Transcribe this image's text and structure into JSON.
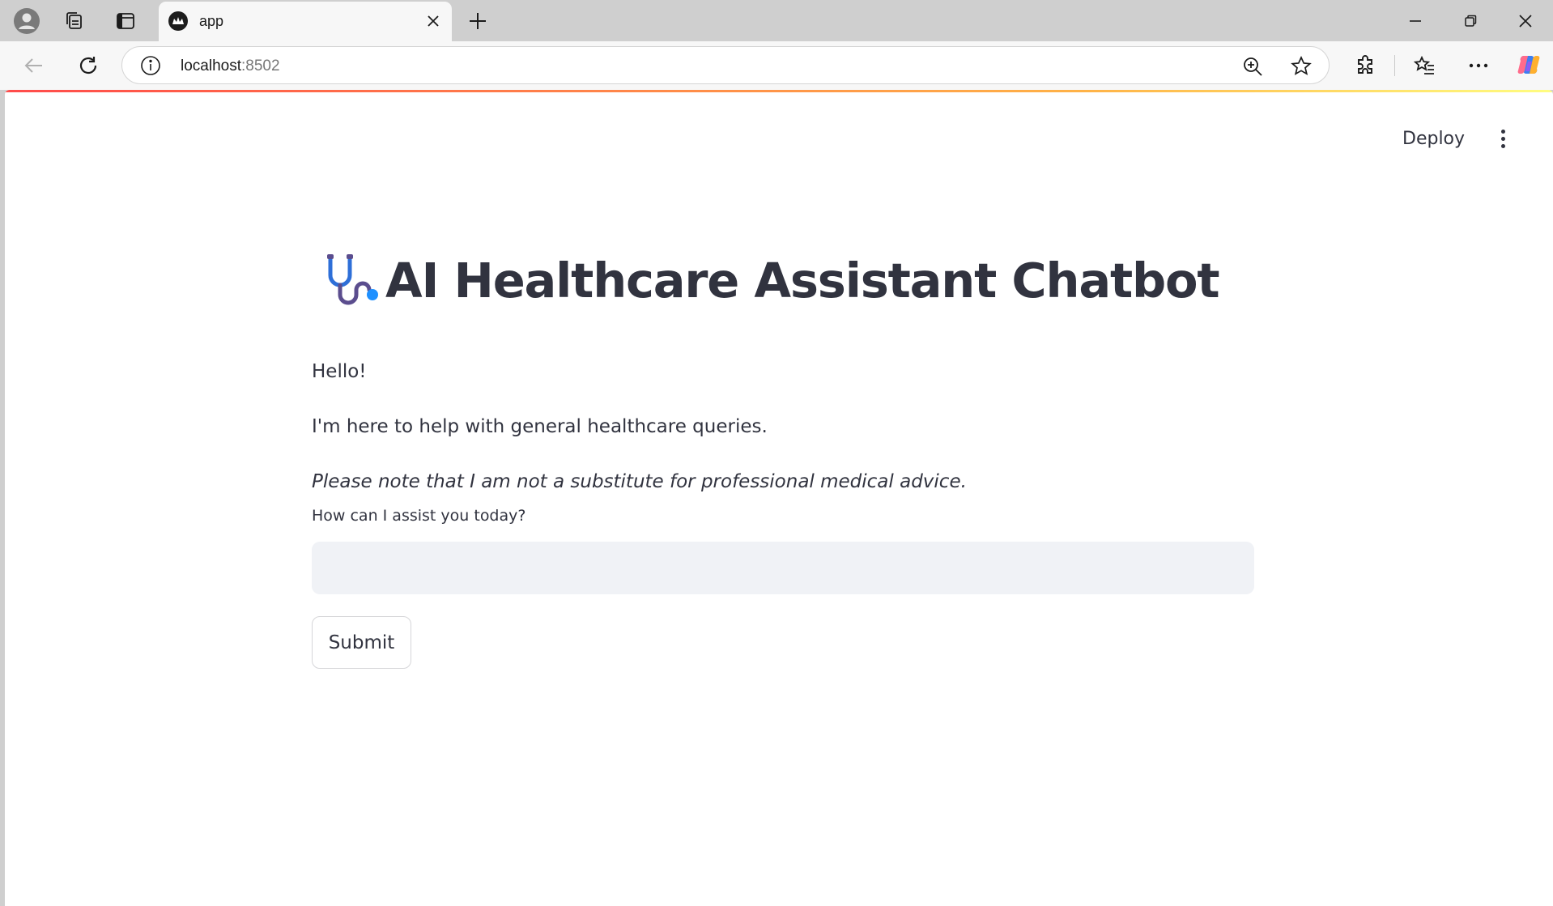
{
  "browser": {
    "tab": {
      "title": "app"
    },
    "address": {
      "host": "localhost",
      "port": ":8502"
    }
  },
  "app": {
    "deploy_label": "Deploy",
    "title": "AI Healthcare Assistant Chatbot",
    "intro": [
      "Hello!",
      "I'm here to help with general healthcare queries.",
      "Please note that I am not a substitute for professional medical advice."
    ],
    "input": {
      "label": "How can I assist you today?",
      "value": "",
      "placeholder": ""
    },
    "submit_label": "Submit"
  },
  "icons": {
    "profile": "profile-icon",
    "collections": "collections-icon",
    "tab_actions": "tab-actions-icon",
    "streamlit": "streamlit-icon",
    "close": "close-icon",
    "new_tab": "plus-icon",
    "minimize": "minimize-icon",
    "restore": "restore-icon",
    "back": "back-arrow-icon",
    "refresh": "refresh-icon",
    "info": "info-icon",
    "zoom": "zoom-in-icon",
    "favorite": "star-icon",
    "extensions": "puzzle-icon",
    "favorites": "favorites-icon",
    "more": "more-icon",
    "copilot": "copilot-icon",
    "stethoscope": "stethoscope-icon"
  },
  "colors": {
    "text": "#31333f",
    "input_bg": "#f0f2f6",
    "accent_red": "#ff4b4b",
    "chrome_bg": "#cfcfcf"
  }
}
